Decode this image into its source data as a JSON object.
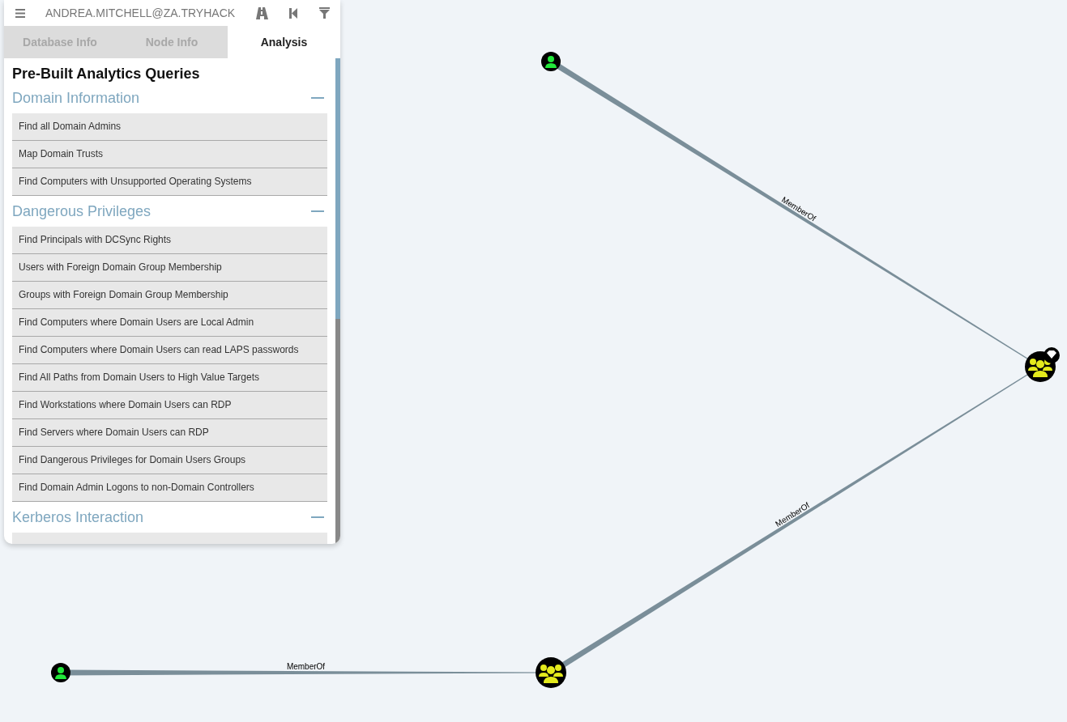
{
  "header": {
    "user": "ANDREA.MITCHELL@ZA.TRYHACK"
  },
  "tabs": [
    {
      "label": "Database Info",
      "selected": false
    },
    {
      "label": "Node Info",
      "selected": false
    },
    {
      "label": "Analysis",
      "selected": true
    }
  ],
  "panel": {
    "title": "Pre-Built Analytics Queries",
    "sections": [
      {
        "title": "Domain Information",
        "expanded": true,
        "queries": [
          "Find all Domain Admins",
          "Map Domain Trusts",
          "Find Computers with Unsupported Operating Systems"
        ]
      },
      {
        "title": "Dangerous Privileges",
        "expanded": true,
        "queries": [
          "Find Principals with DCSync Rights",
          "Users with Foreign Domain Group Membership",
          "Groups with Foreign Domain Group Membership",
          "Find Computers where Domain Users are Local Admin",
          "Find Computers where Domain Users can read LAPS passwords",
          "Find All Paths from Domain Users to High Value Targets",
          "Find Workstations where Domain Users can RDP",
          "Find Servers where Domain Users can RDP",
          "Find Dangerous Privileges for Domain Users Groups",
          "Find Domain Admin Logons to non-Domain Controllers"
        ]
      },
      {
        "title": "Kerberos Interaction",
        "expanded": true
      }
    ]
  },
  "graph": {
    "nodes": [
      {
        "kind": "user",
        "high_value": false
      },
      {
        "kind": "group",
        "high_value": true
      },
      {
        "kind": "group",
        "high_value": false
      },
      {
        "kind": "user",
        "high_value": false
      }
    ],
    "edges": [
      {
        "label": "MemberOf"
      },
      {
        "label": "MemberOf"
      },
      {
        "label": "MemberOf"
      }
    ]
  }
}
